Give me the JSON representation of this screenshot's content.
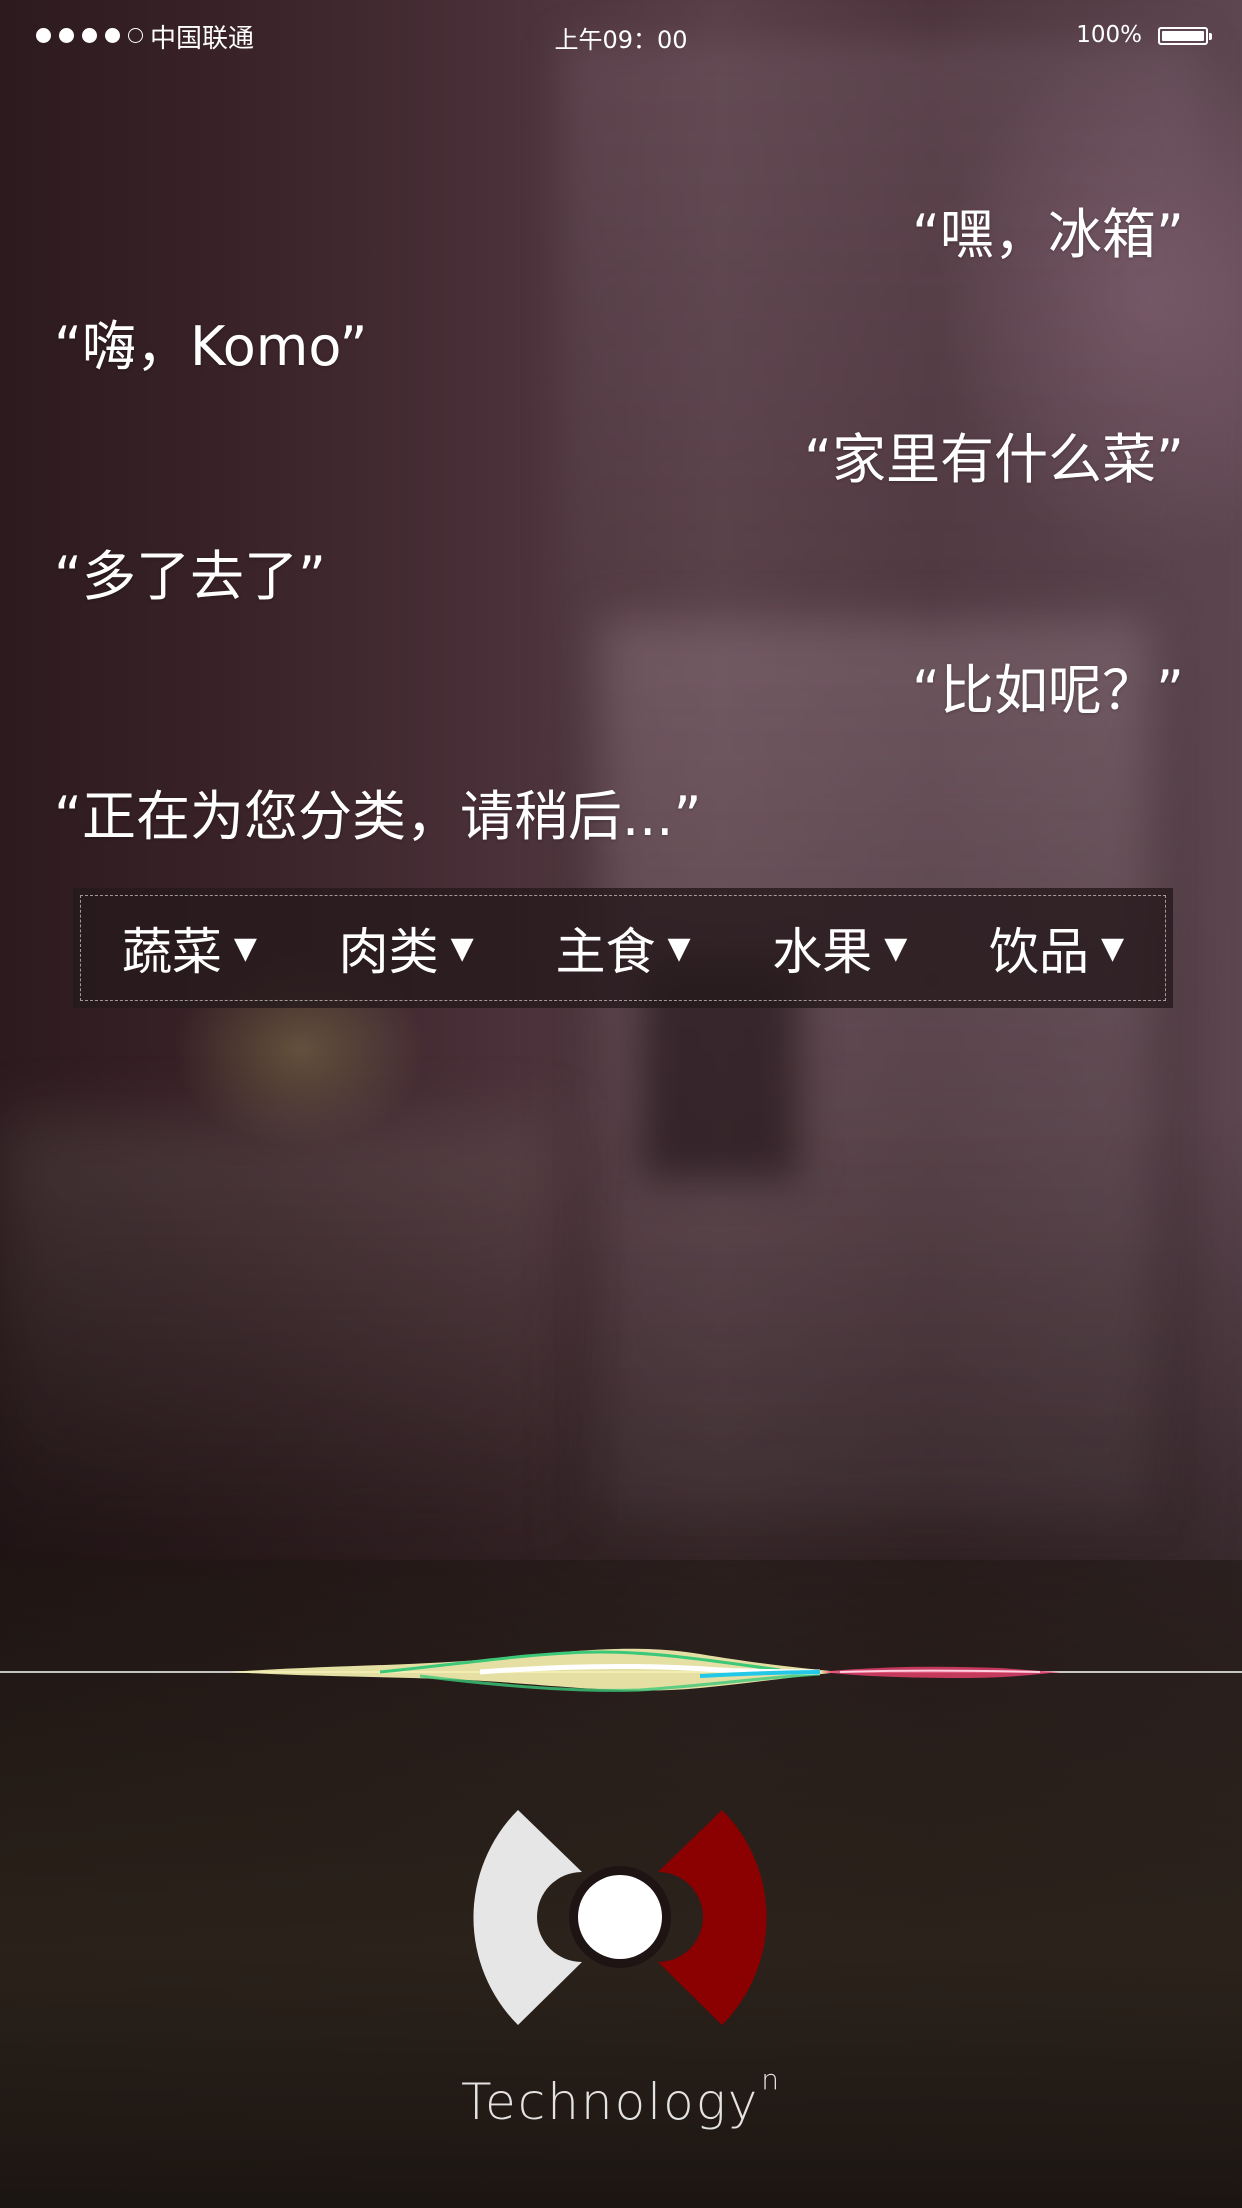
{
  "status_bar": {
    "signal_dots_filled": 4,
    "signal_dots_total": 5,
    "carrier": "中国联通",
    "time": "上午09：00",
    "battery": "100%"
  },
  "conversation": [
    {
      "speaker": "user",
      "text": "“嘿，冰箱”"
    },
    {
      "speaker": "assistant",
      "text": "“嗨，Komo”"
    },
    {
      "speaker": "user",
      "text": "“家里有什么菜”"
    },
    {
      "speaker": "assistant",
      "text": "“多了去了”"
    },
    {
      "speaker": "user",
      "text": "“比如呢？”"
    },
    {
      "speaker": "assistant",
      "text": "“正在为您分类，请稍后...”"
    }
  ],
  "categories": [
    {
      "label": "蔬菜",
      "caret": "▼"
    },
    {
      "label": "肉类",
      "caret": "▼"
    },
    {
      "label": "主食",
      "caret": "▼"
    },
    {
      "label": "水果",
      "caret": "▼"
    },
    {
      "label": "饮品",
      "caret": "▼"
    }
  ],
  "brand": {
    "name": "Technology",
    "superscript": "n"
  },
  "colors": {
    "logo_left": "#e6e6e6",
    "logo_right": "#8b0000",
    "logo_center": "#ffffff",
    "wave_yellow": "#f5f0b0",
    "wave_green": "#3cc878",
    "wave_cyan": "#22c8e6",
    "wave_pink": "#e0406a"
  },
  "icons": [
    "signal-dots-icon",
    "battery-icon",
    "caret-down-icon",
    "siri-waveform",
    "brand-logo-icon"
  ]
}
